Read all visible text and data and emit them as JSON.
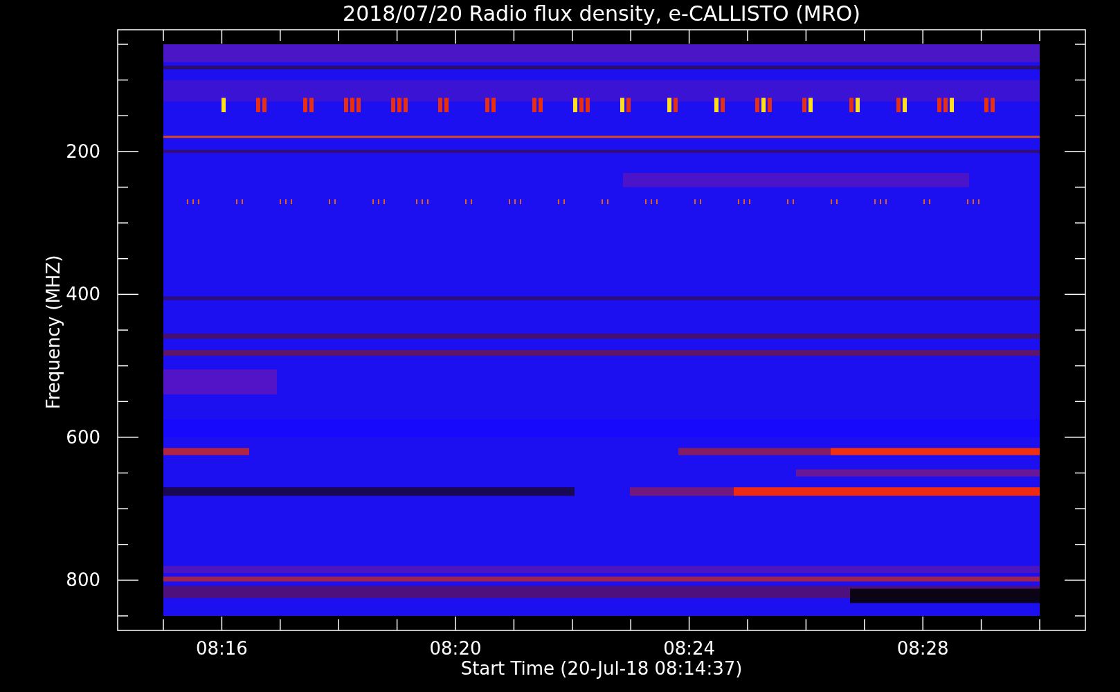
{
  "plot": {
    "title": "2018/07/20  Radio flux density, e-CALLISTO (MRO)",
    "xlabel": "Start Time (20-Jul-18 08:14:37)",
    "ylabel": "Frequency (MHZ)",
    "yticks": [
      "200",
      "400",
      "600",
      "800"
    ],
    "xticks": [
      "08:16",
      "08:20",
      "08:24",
      "08:28"
    ]
  }
}
